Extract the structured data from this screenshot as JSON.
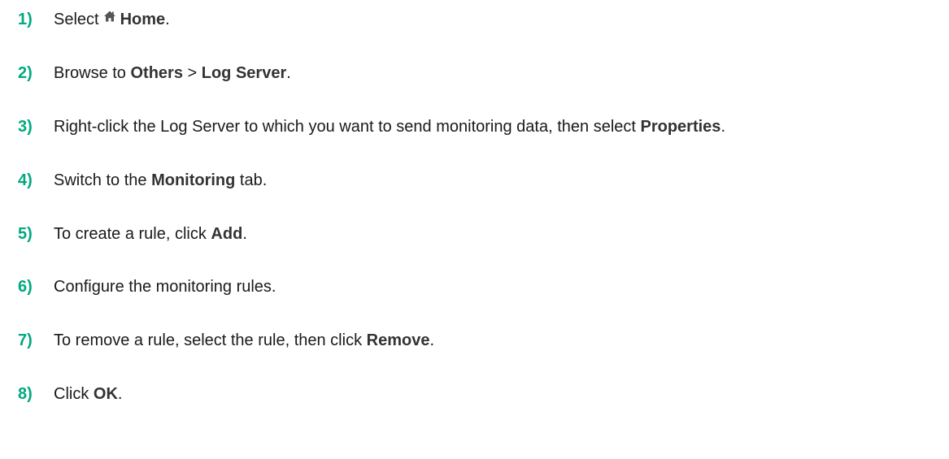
{
  "accent_color": "#01a982",
  "steps": [
    {
      "number": "1)",
      "prefix": "Select",
      "icon": "home-icon",
      "bold": "Home",
      "suffix": "."
    },
    {
      "number": "2)",
      "prefix": "Browse to ",
      "bold1": "Others",
      "separator": " > ",
      "bold2": "Log Server",
      "suffix": "."
    },
    {
      "number": "3)",
      "prefix": "Right-click the Log Server to which you want to send monitoring data, then select ",
      "bold": "Properties",
      "suffix": "."
    },
    {
      "number": "4)",
      "prefix": "Switch to the ",
      "bold": "Monitoring",
      "suffix": " tab."
    },
    {
      "number": "5)",
      "prefix": "To create a rule, click ",
      "bold": "Add",
      "suffix": "."
    },
    {
      "number": "6)",
      "prefix": "Configure the monitoring rules.",
      "bold": "",
      "suffix": ""
    },
    {
      "number": "7)",
      "prefix": "To remove a rule, select the rule, then click ",
      "bold": "Remove",
      "suffix": "."
    },
    {
      "number": "8)",
      "prefix": "Click ",
      "bold": "OK",
      "suffix": "."
    }
  ]
}
